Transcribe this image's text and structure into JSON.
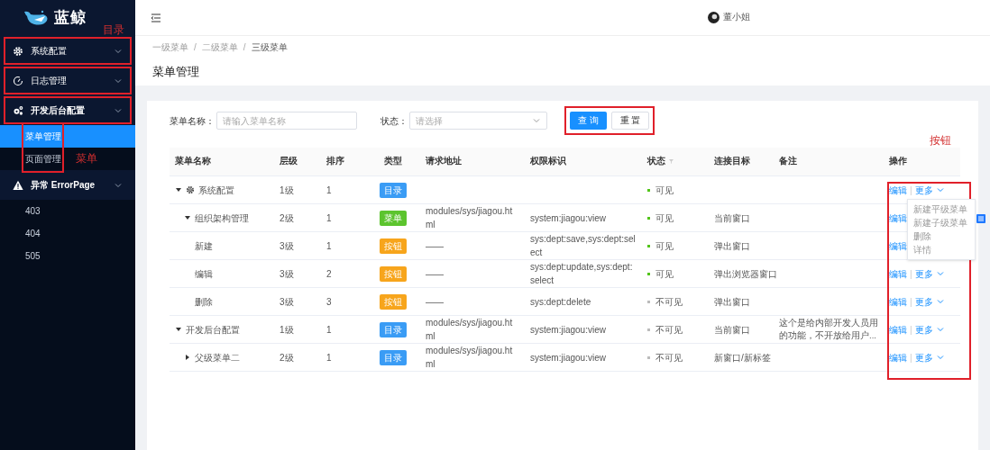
{
  "sidebar": {
    "logo": "蓝鲸",
    "note": "目录",
    "child_note": "菜单",
    "items": [
      {
        "label": "系统配置",
        "expanded": false,
        "boxed": true
      },
      {
        "label": "日志管理",
        "expanded": false,
        "boxed": true
      },
      {
        "label": "开发后台配置",
        "expanded": true,
        "boxed": true,
        "children_boxed": true,
        "children": [
          {
            "label": "菜单管理",
            "selected": true
          },
          {
            "label": "页面管理",
            "selected": false
          }
        ]
      },
      {
        "label": "异常 ErrorPage",
        "expanded": true,
        "boxed": false,
        "children_boxed": false,
        "children": [
          {
            "label": "403",
            "selected": false
          },
          {
            "label": "404",
            "selected": false
          },
          {
            "label": "505",
            "selected": false
          }
        ]
      }
    ]
  },
  "header": {
    "user": "董小姐"
  },
  "breadcrumb": {
    "separator": "/",
    "items": [
      "一级菜单",
      "二级菜单",
      "三级菜单"
    ]
  },
  "page_title": "菜单管理",
  "form": {
    "name_label": "菜单名称：",
    "name_placeholder": "请输入菜单名称",
    "status_label": "状态：",
    "status_placeholder": "请选择",
    "buttons": [
      "查 询",
      "重 置"
    ],
    "buttons_boxed": true
  },
  "table": {
    "note": "按钮",
    "actions_boxed": true,
    "columns": [
      "菜单名称",
      "层级",
      "排序",
      "类型",
      "请求地址",
      "权限标识",
      "状态",
      "连接目标",
      "备注",
      "操作"
    ],
    "rows": [
      {
        "name": "系统配置",
        "expanded": true,
        "level": "1级",
        "order": "1",
        "type": "目录",
        "color": "#3a9cf5",
        "visible": true,
        "status": "可见",
        "actions": {
          "edit": "编辑",
          "separator": "|",
          "more": "更多"
        },
        "menu": [
          "新建平级菜单",
          "新建子级菜单",
          "删除",
          "详情"
        ],
        "children": [
          {
            "name": "组织架构管理",
            "expanded": true,
            "level": "2级",
            "order": "1",
            "type": "菜单",
            "color": "#5cc42e",
            "url": "modules/sys/jiagou.html",
            "perm": "system:jiagou:view",
            "visible": true,
            "status": "可见",
            "target": "当前窗口",
            "actions": {
              "edit": "编辑"
            },
            "children": [
              {
                "name": "新建",
                "level": "3级",
                "order": "1",
                "type": "按钮",
                "color": "#f7a51c",
                "url": "——",
                "perm": "sys:dept:save,sys:dept:select",
                "visible": true,
                "status": "可见",
                "target": "弹出窗口",
                "actions": {
                  "edit": "编辑"
                }
              },
              {
                "name": "编辑",
                "level": "3级",
                "order": "2",
                "type": "按钮",
                "color": "#f7a51c",
                "url": "——",
                "perm": "sys:dept:update,sys:dept:select",
                "visible": true,
                "status": "可见",
                "target": "弹出浏览器窗口",
                "actions": {
                  "edit": "编辑",
                  "separator": "|",
                  "more": "更多"
                }
              },
              {
                "name": "删除",
                "level": "3级",
                "order": "3",
                "type": "按钮",
                "color": "#f7a51c",
                "url": "——",
                "perm": "sys:dept:delete",
                "visible": false,
                "status": "不可见",
                "target": "弹出窗口",
                "actions": {
                  "edit": "编辑",
                  "separator": "|",
                  "more": "更多"
                }
              }
            ]
          }
        ]
      },
      {
        "name": "开发后台配置",
        "expanded": true,
        "level": "1级",
        "order": "1",
        "type": "目录",
        "color": "#3a9cf5",
        "url": "modules/sys/jiagou.html",
        "perm": "system:jiagou:view",
        "visible": false,
        "status": "不可见",
        "target": "当前窗口",
        "remark": "这个是给内部开发人员用的功能，不开放给用户...",
        "actions": {
          "edit": "编辑",
          "separator": "|",
          "more": "更多"
        },
        "children": [
          {
            "name": "父级菜单二",
            "expanded": false,
            "level": "2级",
            "order": "1",
            "type": "目录",
            "color": "#3a9cf5",
            "url": "modules/sys/jiagou.html",
            "perm": "system:jiagou:view",
            "visible": false,
            "status": "不可见",
            "target": "新窗口/新标签",
            "actions": {
              "edit": "编辑",
              "separator": "|",
              "more": "更多"
            }
          }
        ]
      }
    ]
  }
}
